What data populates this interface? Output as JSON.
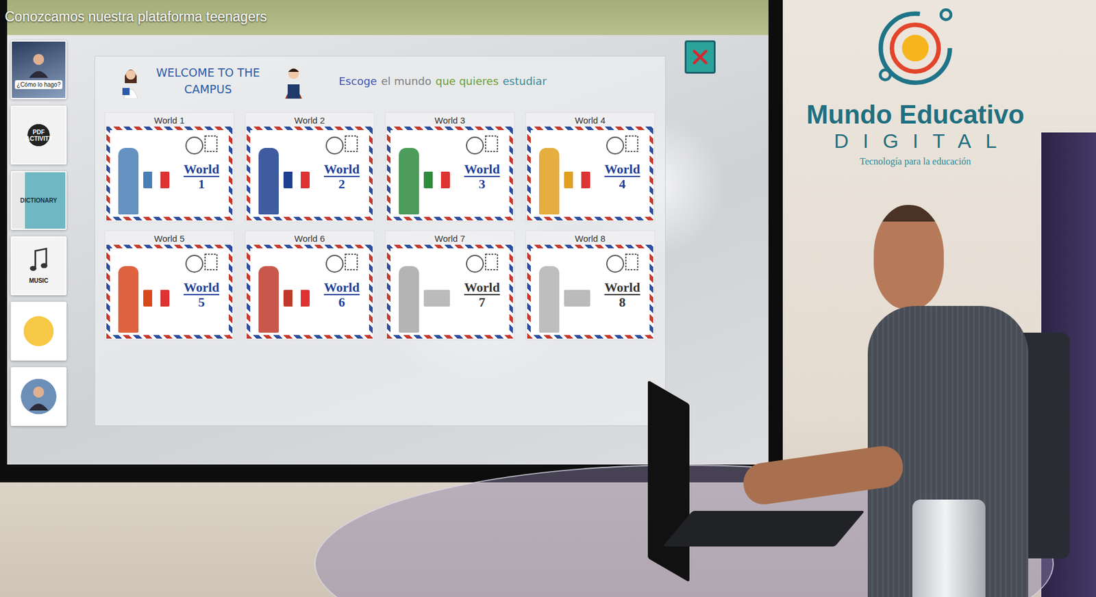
{
  "video_title": "Conozcamos nuestra plataforma teenagers",
  "sidebar": {
    "items": [
      {
        "kind": "video",
        "label": "¿Cómo lo hago?"
      },
      {
        "kind": "pdf",
        "label": "PDF ACTIVITY"
      },
      {
        "kind": "dictionary",
        "label": "DICTIONARY"
      },
      {
        "kind": "music",
        "label": "MUSIC"
      },
      {
        "kind": "quiz"
      },
      {
        "kind": "support"
      }
    ]
  },
  "campus": {
    "welcome": "WELCOME TO THE CAMPUS",
    "prompt": [
      {
        "text": "Escoge",
        "color": "#3a57b0"
      },
      {
        "text": "el mundo",
        "color": "#7d7d7d"
      },
      {
        "text": "que quieres",
        "color": "#6aa02a"
      },
      {
        "text": "estudiar",
        "color": "#3b8ca0"
      }
    ],
    "worlds": [
      {
        "title": "World 1",
        "stamp": "World",
        "number": "1",
        "color": "#4a7fb5",
        "colored": true
      },
      {
        "title": "World 2",
        "stamp": "World",
        "number": "2",
        "color": "#1f3f8f",
        "colored": true
      },
      {
        "title": "World 3",
        "stamp": "World",
        "number": "3",
        "color": "#2e8b3e",
        "colored": true
      },
      {
        "title": "World 4",
        "stamp": "World",
        "number": "4",
        "color": "#e0a020",
        "colored": true
      },
      {
        "title": "World 5",
        "stamp": "World",
        "number": "5",
        "color": "#d9481c",
        "colored": true
      },
      {
        "title": "World 6",
        "stamp": "World",
        "number": "6",
        "color": "#c0392b",
        "colored": true
      },
      {
        "title": "World 7",
        "stamp": "World",
        "number": "7",
        "color": "#777777",
        "colored": false
      },
      {
        "title": "World 8",
        "stamp": "World",
        "number": "8",
        "color": "#888888",
        "colored": false
      }
    ]
  },
  "logo": {
    "name": "Mundo Educativo",
    "sub": "DIGITAL",
    "tagline": "Tecnología para la educación"
  }
}
